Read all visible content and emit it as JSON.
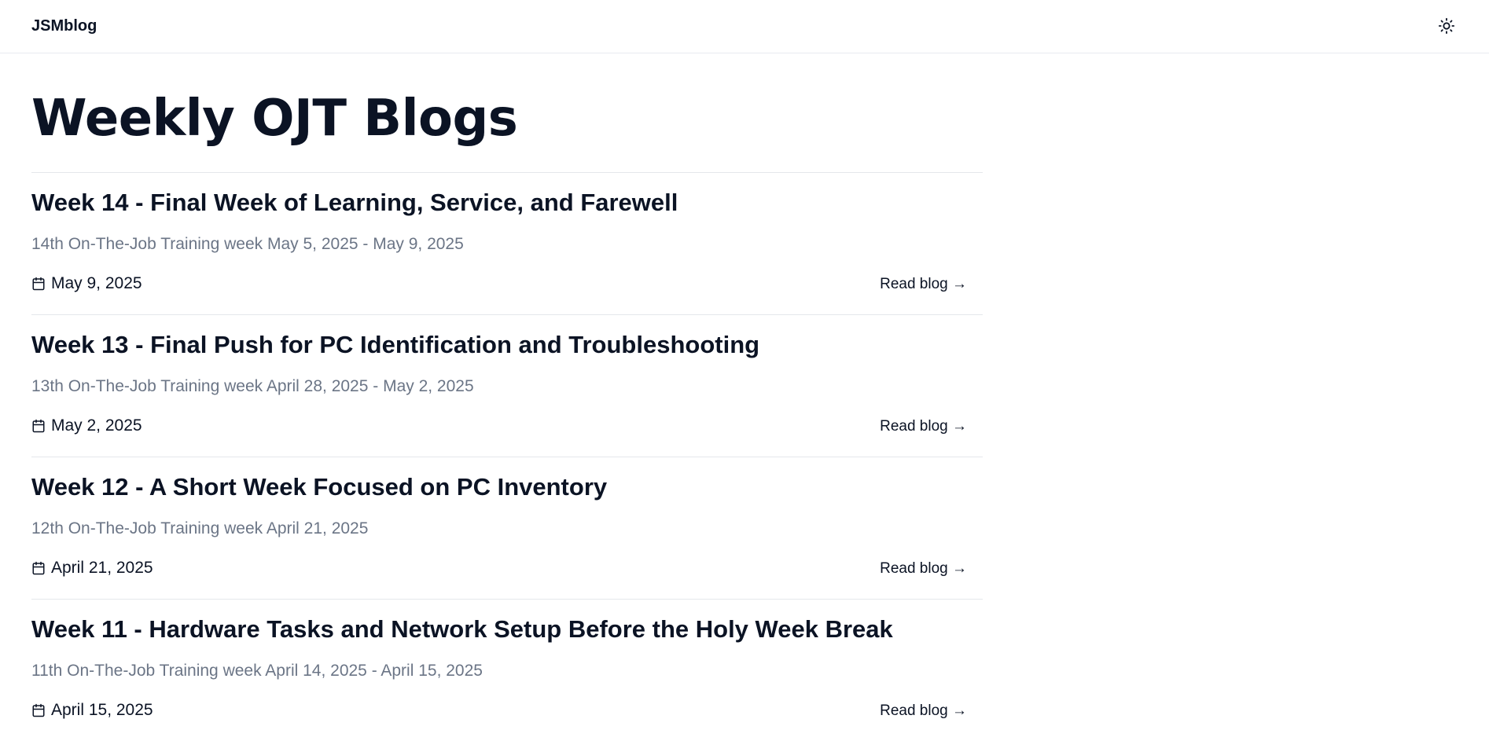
{
  "site": {
    "brand": "JSMblog",
    "theme_icon": "sun-icon"
  },
  "page": {
    "title": "Weekly OJT Blogs"
  },
  "posts": [
    {
      "title": "Week 14 - Final Week of Learning, Service, and Farewell",
      "description": "14th On-The-Job Training week May 5, 2025 - May 9, 2025",
      "date": "May 9, 2025",
      "read_label": "Read blog →"
    },
    {
      "title": "Week 13 - Final Push for PC Identification and Troubleshooting",
      "description": "13th On-The-Job Training week April 28, 2025 - May 2, 2025",
      "date": "May 2, 2025",
      "read_label": "Read blog →"
    },
    {
      "title": "Week 12 - A Short Week Focused on PC Inventory",
      "description": "12th On-The-Job Training week April 21, 2025",
      "date": "April 21, 2025",
      "read_label": "Read blog →"
    },
    {
      "title": "Week 11 - Hardware Tasks and Network Setup Before the Holy Week Break",
      "description": "11th On-The-Job Training week April 14, 2025 - April 15, 2025",
      "date": "April 15, 2025",
      "read_label": "Read blog →"
    }
  ],
  "colors": {
    "text": "#0b1324",
    "muted": "#6b7586",
    "divider": "#e5e7eb",
    "background": "#ffffff"
  }
}
